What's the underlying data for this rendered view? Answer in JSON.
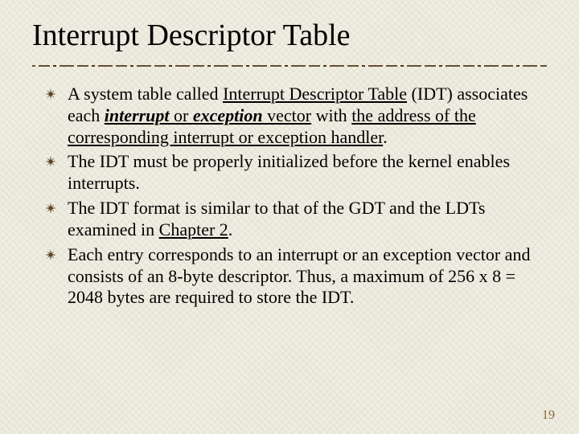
{
  "title": "Interrupt Descriptor Table",
  "bullets": {
    "b1": {
      "pre": "A system table called ",
      "t1": "Interrupt Descriptor Table",
      "mid1": " (IDT) associates each ",
      "t2": "interrupt",
      "mid2": " or ",
      "t3": "exception",
      "mid3": " vector",
      "mid4": " with ",
      "t4": "the address of the corresponding interrupt or exception handler",
      "post": "."
    },
    "b2": "The IDT must be properly initialized before the kernel enables interrupts.",
    "b3": {
      "pre": "The IDT format is similar to that of the GDT and the LDTs examined in ",
      "link": "Chapter 2",
      "post": "."
    },
    "b4": "Each entry corresponds to an interrupt or an exception vector and consists of an 8-byte descriptor. Thus, a maximum of 256 x 8 = 2048 bytes are required to store the IDT."
  },
  "page_number": "19"
}
